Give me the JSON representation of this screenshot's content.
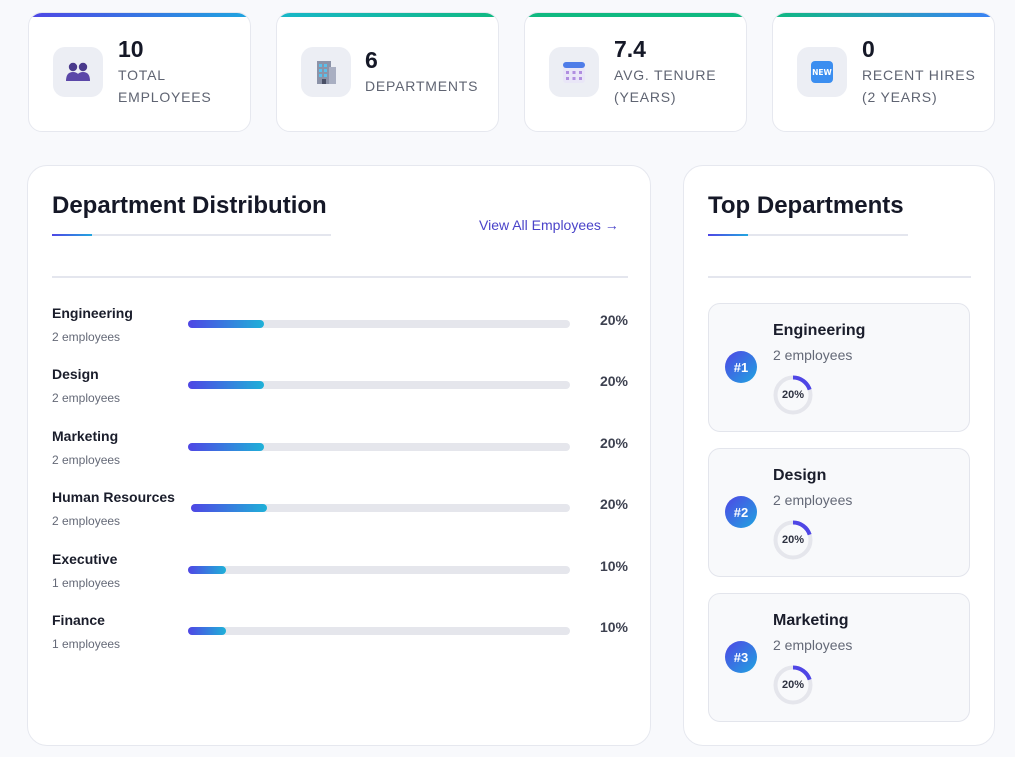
{
  "stats": [
    {
      "value": "10",
      "label_line1": "TOTAL",
      "label_line2": "EMPLOYEES",
      "icon": "people-icon",
      "bar_color": "#4f46e5",
      "bar_color_end": "#1fa5e0"
    },
    {
      "value": "6",
      "label_line1": "DEPARTMENTS",
      "label_line2": "",
      "icon": "office-building-icon",
      "bar_color": "#18b7c9",
      "bar_color_end": "#10b981"
    },
    {
      "value": "7.4",
      "label_line1": "AVG. TENURE",
      "label_line2": "(YEARS)",
      "icon": "calendar-icon",
      "bar_color": "#10b981",
      "bar_color_end": "#10b981"
    },
    {
      "value": "0",
      "label_line1": "RECENT HIRES",
      "label_line2": "(2 YEARS)",
      "icon": "new-badge-icon",
      "bar_color": "#10b981",
      "bar_color_end": "#3b82f6"
    }
  ],
  "distribution": {
    "title": "Department Distribution",
    "view_all_label": "View All Employees →",
    "rows": [
      {
        "name": "Engineering",
        "count": "2 employees",
        "percent_label": "20%",
        "fraction": 0.2
      },
      {
        "name": "Design",
        "count": "2 employees",
        "percent_label": "20%",
        "fraction": 0.2
      },
      {
        "name": "Marketing",
        "count": "2 employees",
        "percent_label": "20%",
        "fraction": 0.2
      },
      {
        "name": "Human Resources",
        "count": "2 employees",
        "percent_label": "20%",
        "fraction": 0.2
      },
      {
        "name": "Executive",
        "count": "1 employees",
        "percent_label": "10%",
        "fraction": 0.1
      },
      {
        "name": "Finance",
        "count": "1 employees",
        "percent_label": "10%",
        "fraction": 0.1
      }
    ]
  },
  "top_departments": {
    "title": "Top Departments",
    "items": [
      {
        "rank": "#1",
        "name": "Engineering",
        "count": "2 employees",
        "percent_label": "20%",
        "fraction": 0.2
      },
      {
        "rank": "#2",
        "name": "Design",
        "count": "2 employees",
        "percent_label": "20%",
        "fraction": 0.2
      },
      {
        "rank": "#3",
        "name": "Marketing",
        "count": "2 employees",
        "percent_label": "20%",
        "fraction": 0.2
      }
    ]
  },
  "colors": {
    "accent": "#4f46e5",
    "accent_secondary": "#1fa5e0",
    "link": "#4a43c9",
    "track": "#e5e6ec"
  }
}
